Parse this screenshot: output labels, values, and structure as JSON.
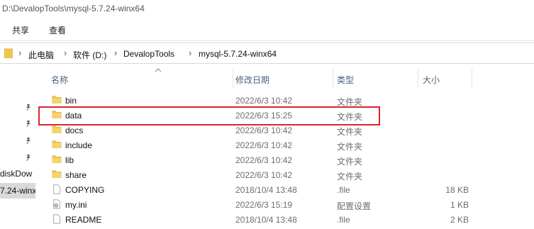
{
  "window": {
    "title": "D:\\DevalopTools\\mysql-5.7.24-winx64"
  },
  "ribbon": {
    "tabs": [
      "共享",
      "查看"
    ]
  },
  "address": {
    "crumbs": [
      "此电脑",
      "软件 (D:)",
      "DevalopTools",
      "mysql-5.7.24-winx64"
    ]
  },
  "navpane": {
    "items": [
      "diskDow",
      "7.24-winx"
    ]
  },
  "columns": {
    "name": "名称",
    "date": "修改日期",
    "type": "类型",
    "size": "大小"
  },
  "files": [
    {
      "name": "bin",
      "date": "2022/6/3 10:42",
      "type": "文件夹",
      "size": "",
      "icon": "folder-icon"
    },
    {
      "name": "data",
      "date": "2022/6/3 15:25",
      "type": "文件夹",
      "size": "",
      "icon": "folder-icon"
    },
    {
      "name": "docs",
      "date": "2022/6/3 10:42",
      "type": "文件夹",
      "size": "",
      "icon": "folder-icon"
    },
    {
      "name": "include",
      "date": "2022/6/3 10:42",
      "type": "文件夹",
      "size": "",
      "icon": "folder-icon"
    },
    {
      "name": "lib",
      "date": "2022/6/3 10:42",
      "type": "文件夹",
      "size": "",
      "icon": "folder-icon"
    },
    {
      "name": "share",
      "date": "2022/6/3 10:42",
      "type": "文件夹",
      "size": "",
      "icon": "folder-icon"
    },
    {
      "name": "COPYING",
      "date": "2018/10/4 13:48",
      "type": ".file",
      "size": "18 KB",
      "icon": "file-icon"
    },
    {
      "name": "my.ini",
      "date": "2022/6/3 15:19",
      "type": "配置设置",
      "size": "1 KB",
      "icon": "settings-file-icon"
    },
    {
      "name": "README",
      "date": "2018/10/4 13:48",
      "type": ".file",
      "size": "2 KB",
      "icon": "file-icon"
    }
  ],
  "colors": {
    "highlight": "#d9262d",
    "folder": "#f3c64f",
    "header_text": "#4d6082"
  }
}
